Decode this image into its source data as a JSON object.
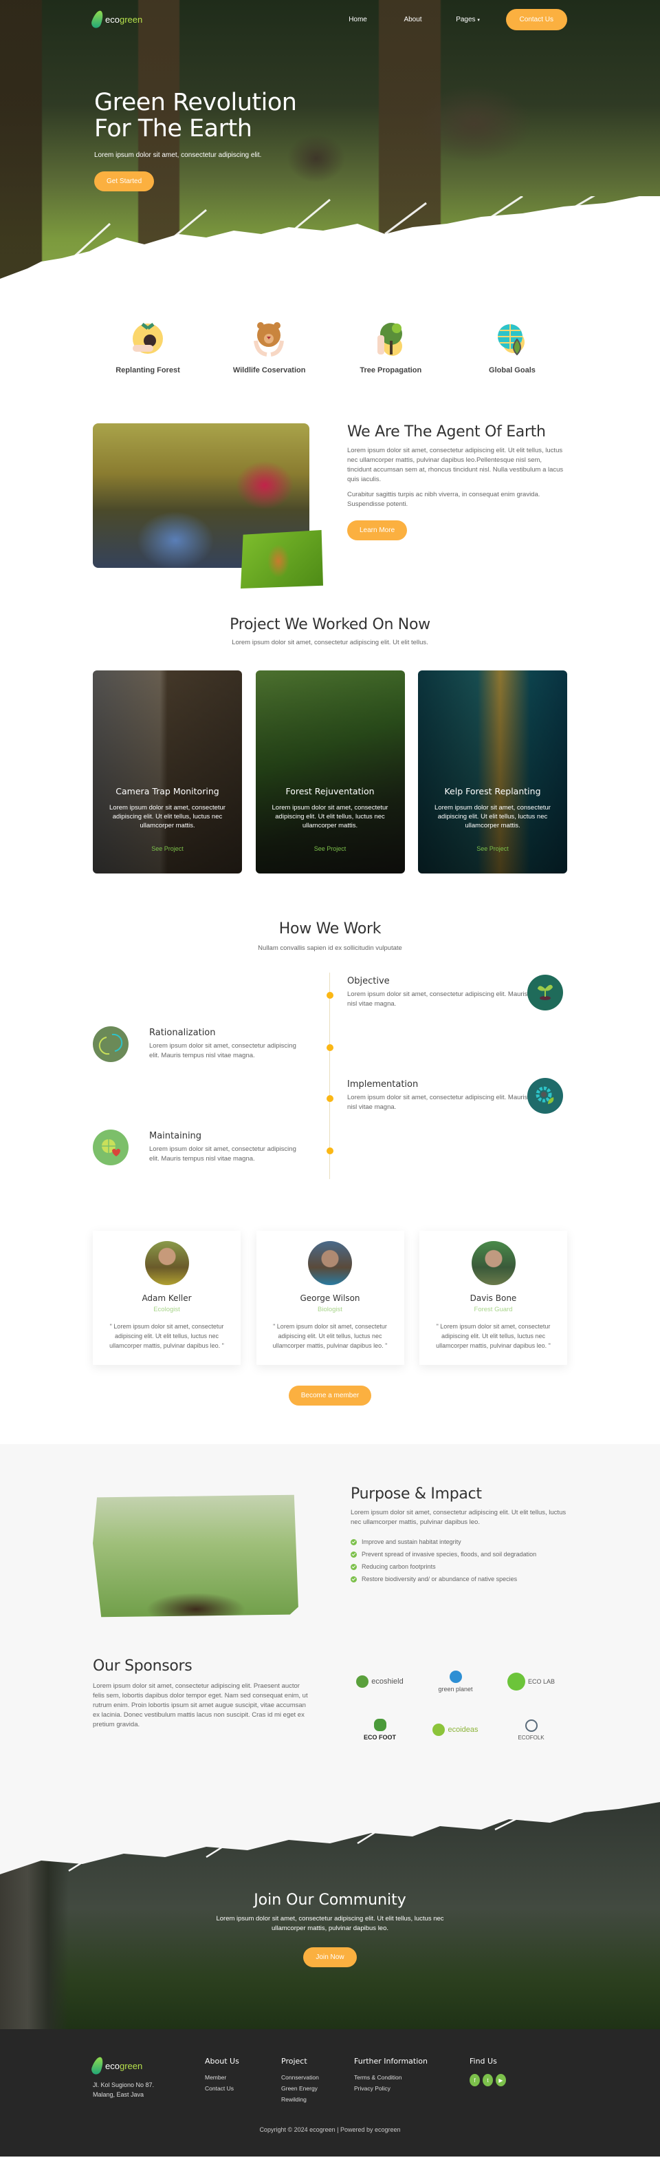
{
  "nav": {
    "logo_eco": "eco",
    "logo_green": "green",
    "links": [
      "Home",
      "About",
      "Pages"
    ],
    "pages_chevron": "chevron-down",
    "contact_label": "Contact Us"
  },
  "hero": {
    "title_line1": "Green Revolution",
    "title_line2": "For The Earth",
    "subtitle": "Lorem ipsum dolor sit amet, consectetur adipiscing elit.",
    "cta": "Get Started"
  },
  "features": [
    {
      "label": "Replanting Forest",
      "icon": "seedling-hand-icon"
    },
    {
      "label": "Wildlife Coservation",
      "icon": "bear-hands-icon"
    },
    {
      "label": "Tree Propagation",
      "icon": "tree-icon"
    },
    {
      "label": "Global Goals",
      "icon": "globe-leaf-icon"
    }
  ],
  "agent": {
    "title": "We Are The Agent Of Earth",
    "p1": "Lorem ipsum dolor sit amet, consectetur adipiscing elit. Ut elit tellus, luctus nec ullamcorper mattis, pulvinar dapibus leo.Pellentesque nisl sem, tincidunt accumsan sem at, rhoncus tincidunt nisl. Nulla vestibulum a lacus quis iaculis.",
    "p2": "Curabitur sagittis turpis ac nibh viverra, in consequat enim gravida. Suspendisse potenti.",
    "cta": "Learn More"
  },
  "projects": {
    "title": "Project We Worked On Now",
    "subtitle": "Lorem ipsum dolor sit amet, consectetur adipiscing elit. Ut elit tellus.",
    "items": [
      {
        "title": "Camera Trap Monitoring",
        "text": "Lorem ipsum dolor sit amet, consectetur adipiscing elit. Ut elit tellus, luctus nec ullamcorper mattis.",
        "link": "See Project"
      },
      {
        "title": "Forest Rejuventation",
        "text": "Lorem ipsum dolor sit amet, consectetur adipiscing elit. Ut elit tellus, luctus nec ullamcorper mattis.",
        "link": "See Project"
      },
      {
        "title": "Kelp Forest Replanting",
        "text": "Lorem ipsum dolor sit amet, consectetur adipiscing elit. Ut elit tellus, luctus nec ullamcorper mattis.",
        "link": "See Project"
      }
    ]
  },
  "how": {
    "title": "How We Work",
    "subtitle": "Nullam convallis sapien id ex sollicitudin vulputate",
    "steps": [
      {
        "title": "Objective",
        "text": "Lorem ipsum dolor sit amet, consectetur adipiscing elit. Mauris tempus nisl vitae magna.",
        "icon": "sprout-icon"
      },
      {
        "title": "Rationalization",
        "text": "Lorem ipsum dolor sit amet, consectetur adipiscing elit. Mauris tempus nisl vitae magna.",
        "icon": "recycle-arrows-icon"
      },
      {
        "title": "Implementation",
        "text": "Lorem ipsum dolor sit amet, consectetur adipiscing elit. Mauris tempus nisl vitae magna.",
        "icon": "gear-leaf-icon"
      },
      {
        "title": "Maintaining",
        "text": "Lorem ipsum dolor sit amet, consectetur adipiscing elit. Mauris tempus nisl vitae magna.",
        "icon": "globe-heart-icon"
      }
    ]
  },
  "team": {
    "members": [
      {
        "name": "Adam Keller",
        "role": "Ecologist",
        "quote": "\" Lorem ipsum dolor sit amet, consectetur adipiscing elit. Ut elit tellus, luctus nec ullamcorper mattis, pulvinar dapibus leo. \""
      },
      {
        "name": "George Wilson",
        "role": "Biologist",
        "quote": "\" Lorem ipsum dolor sit amet, consectetur adipiscing elit. Ut elit tellus, luctus nec ullamcorper mattis, pulvinar dapibus leo. \""
      },
      {
        "name": "Davis Bone",
        "role": "Forest Guard",
        "quote": "\" Lorem ipsum dolor sit amet, consectetur adipiscing elit. Ut elit tellus, luctus nec ullamcorper mattis, pulvinar dapibus leo. \""
      }
    ],
    "cta": "Become a member"
  },
  "purpose": {
    "title": "Purpose & Impact",
    "text": "Lorem ipsum dolor sit amet, consectetur adipiscing elit. Ut elit tellus, luctus nec ullamcorper mattis, pulvinar dapibus leo.",
    "items": [
      "Improve and sustain habitat integrity",
      "Prevent spread of invasive species, floods, and soil degradation",
      "Reducing carbon footprints",
      "Restore biodiversity and/ or abundance of native species"
    ]
  },
  "sponsors": {
    "title": "Our Sponsors",
    "text": "Lorem ipsum dolor sit amet, consectetur adipiscing elit. Praesent auctor felis sem, lobortis dapibus dolor tempor eget. Nam sed consequat enim, ut rutrum enim. Proin lobortis ipsum sit amet augue suscipit, vitae accumsan ex lacinia. Donec vestibulum mattis lacus non suscipit. Cras id mi eget ex pretium gravida.",
    "logos": [
      {
        "name": "ecoshield",
        "color": "#5aa03c"
      },
      {
        "name": "green planet",
        "color": "#2d8fd4"
      },
      {
        "name": "ECO LAB",
        "color": "#6cc43a"
      },
      {
        "name": "ECO FOOT",
        "color": "#4b9a3a"
      },
      {
        "name": "ecoideas",
        "color": "#8cc43a"
      },
      {
        "name": "ECOFOLK",
        "color": "#5a6b7a"
      }
    ]
  },
  "community": {
    "title": "Join Our Community",
    "text": "Lorem ipsum dolor sit amet, consectetur adipiscing elit. Ut elit tellus, luctus nec ullamcorper mattis, pulvinar dapibus leo.",
    "cta": "Join Now"
  },
  "footer": {
    "address_line1": "Jl. Kol Sugiono No 87.",
    "address_line2": "Malang, East Java",
    "columns": [
      {
        "title": "About Us",
        "links": [
          "Member",
          "Contact Us"
        ]
      },
      {
        "title": "Project",
        "links": [
          "Connservation",
          "Green Energy",
          "Rewilding"
        ]
      },
      {
        "title": "Further Information",
        "links": [
          "Terms & Condition",
          "Privacy Policy"
        ]
      }
    ],
    "find_us": "Find Us",
    "socials": [
      "facebook",
      "twitter",
      "youtube"
    ],
    "copyright": "Copyright © 2024 ecogreen | Powered by ecogreen"
  },
  "colors": {
    "accent": "#fbb040",
    "green": "#7cc04b",
    "footer_bg": "#272727"
  }
}
